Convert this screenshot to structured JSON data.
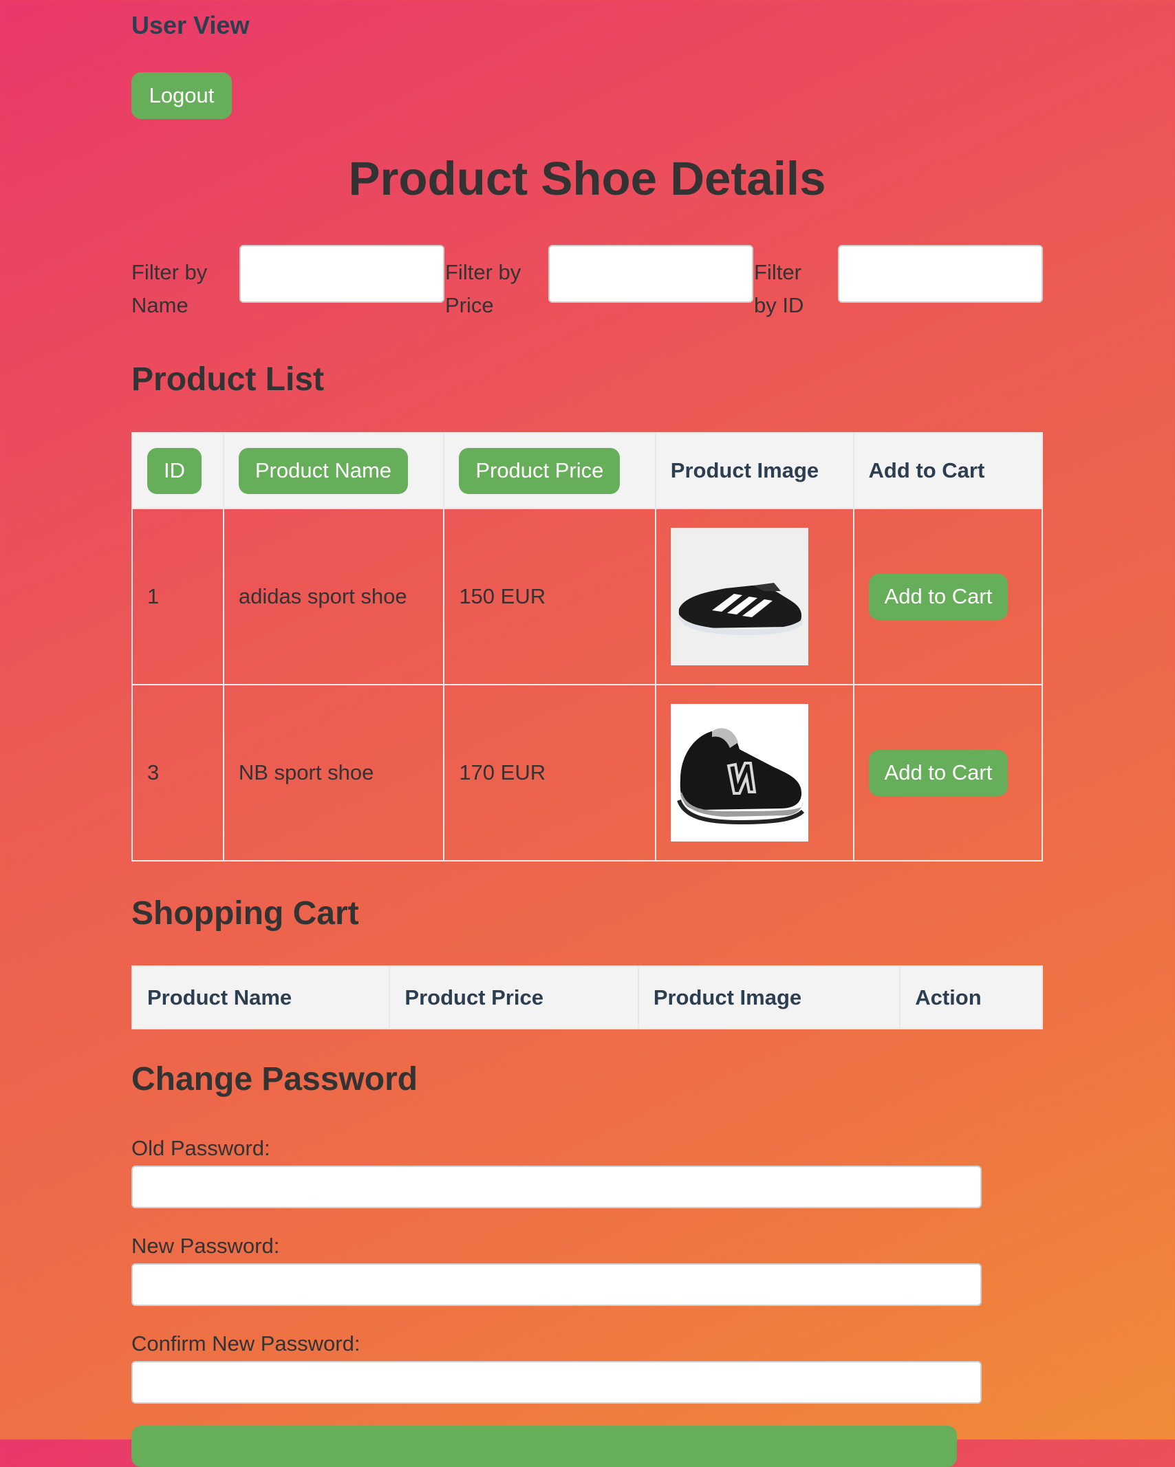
{
  "header": {
    "title": "User View",
    "logout_label": "Logout"
  },
  "page_title": "Product Shoe Details",
  "filters": [
    {
      "label_line1": "Filter by",
      "label_line2": "Name",
      "value": ""
    },
    {
      "label_line1": "Filter by",
      "label_line2": "Price",
      "value": ""
    },
    {
      "label_line1": "Filter",
      "label_line2": "by ID",
      "value": ""
    }
  ],
  "product_list": {
    "heading": "Product List",
    "columns": [
      "ID",
      "Product Name",
      "Product Price",
      "Product Image",
      "Add to Cart"
    ],
    "rows": [
      {
        "id": "1",
        "name": "adidas sport shoe",
        "price": "150 EUR",
        "image": "adidas-shoe-image",
        "action": "Add to Cart"
      },
      {
        "id": "3",
        "name": "NB sport shoe",
        "price": "170 EUR",
        "image": "nb-shoe-image",
        "action": "Add to Cart"
      }
    ]
  },
  "cart": {
    "heading": "Shopping Cart",
    "columns": [
      "Product Name",
      "Product Price",
      "Product Image",
      "Action"
    ]
  },
  "change_password": {
    "heading": "Change Password",
    "old_label": "Old Password:",
    "new_label": "New Password:",
    "confirm_label": "Confirm New Password:"
  },
  "colors": {
    "accent": "#66ae59",
    "gradient_start": "#e9386a",
    "gradient_end": "#f08c38",
    "table_header_bg": "#f3f3f3"
  }
}
